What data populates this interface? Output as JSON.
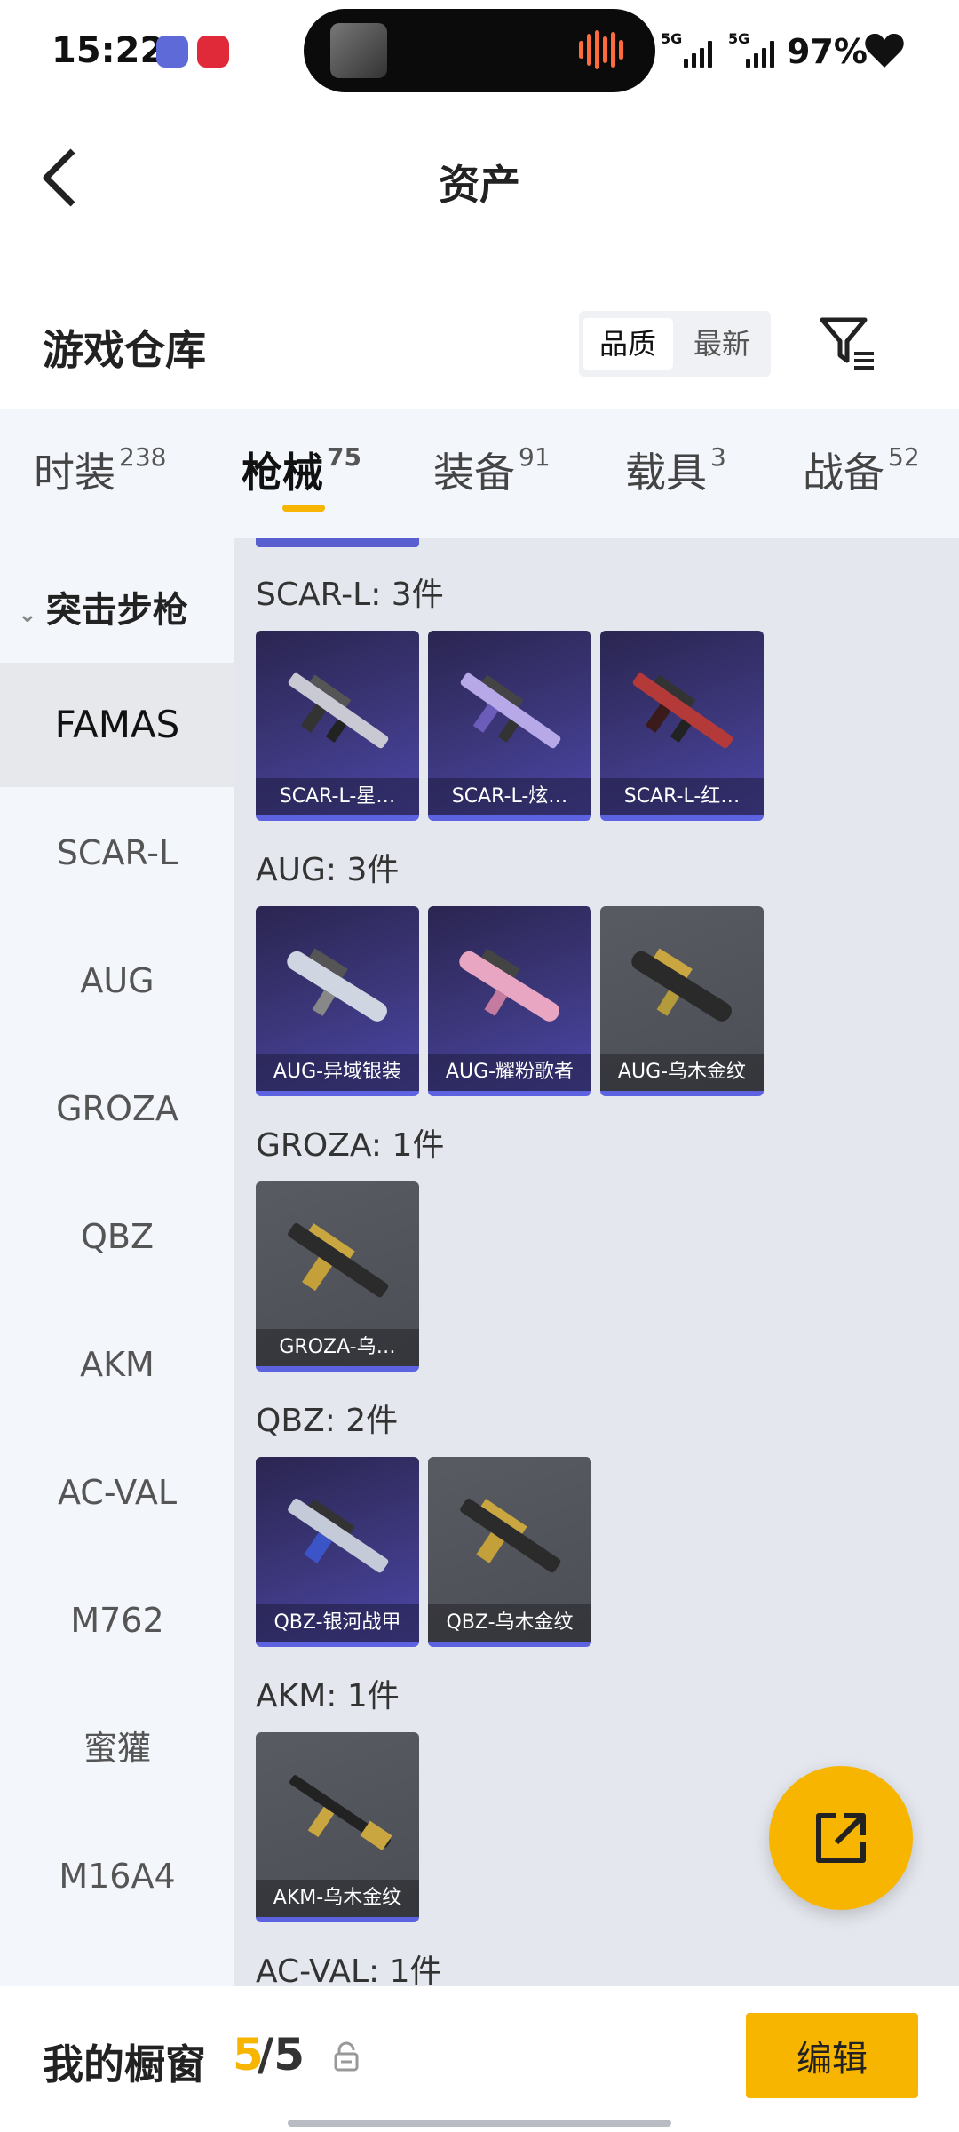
{
  "status_bar": {
    "time": "15:22",
    "network_1": "5G",
    "network_2": "5G",
    "battery": "97%"
  },
  "header": {
    "title": "资产",
    "back_icon": "back-arrow-icon"
  },
  "section": {
    "title": "游戏仓库",
    "sort_options": [
      "品质",
      "最新"
    ],
    "active_sort": "品质",
    "filter_icon": "filter-icon"
  },
  "tabs": [
    {
      "label": "时装",
      "count": "238"
    },
    {
      "label": "枪械",
      "count": "75"
    },
    {
      "label": "装备",
      "count": "91"
    },
    {
      "label": "载具",
      "count": "3"
    },
    {
      "label": "战备",
      "count": "52"
    }
  ],
  "active_tab": "枪械",
  "sidebar": {
    "category": "突击步枪",
    "items": [
      "FAMAS",
      "SCAR-L",
      "AUG",
      "GROZA",
      "QBZ",
      "AKM",
      "AC-VAL",
      "M762",
      "蜜獾",
      "M16A4"
    ],
    "active_item": "FAMAS"
  },
  "groups": [
    {
      "label": "SCAR-L: 3件",
      "items": [
        {
          "name": "SCAR-L-星…",
          "rarity": "epic"
        },
        {
          "name": "SCAR-L-炫…",
          "rarity": "epic"
        },
        {
          "name": "SCAR-L-红…",
          "rarity": "epic"
        }
      ]
    },
    {
      "label": "AUG: 3件",
      "items": [
        {
          "name": "AUG-异域银装",
          "rarity": "epic"
        },
        {
          "name": "AUG-耀粉歌者",
          "rarity": "epic"
        },
        {
          "name": "AUG-乌木金纹",
          "rarity": "common"
        }
      ]
    },
    {
      "label": "GROZA: 1件",
      "items": [
        {
          "name": "GROZA-乌…",
          "rarity": "common"
        }
      ]
    },
    {
      "label": "QBZ: 2件",
      "items": [
        {
          "name": "QBZ-银河战甲",
          "rarity": "epic"
        },
        {
          "name": "QBZ-乌木金纹",
          "rarity": "common"
        }
      ]
    },
    {
      "label": "AKM: 1件",
      "items": [
        {
          "name": "AKM-乌木金纹",
          "rarity": "common"
        }
      ]
    },
    {
      "label": "AC-VAL: 1件",
      "items": []
    }
  ],
  "bottom_bar": {
    "label": "我的橱窗",
    "current": "5",
    "rest": "/5",
    "edit_label": "编辑"
  },
  "colors": {
    "accent": "#f7b500",
    "epic_card": "#3b3678",
    "common_card": "#4b4e55",
    "rarity_bar": "#5d63e0"
  }
}
